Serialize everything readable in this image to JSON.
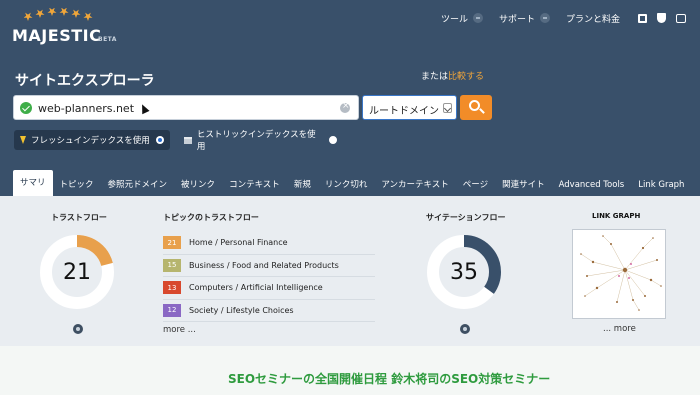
{
  "logo": {
    "name": "MAJESTIC",
    "beta": "BETA"
  },
  "topnav": {
    "tools": "ツール",
    "support": "サポート",
    "pricing": "プランと料金"
  },
  "page_title": "サイトエクスプローラ",
  "compare": {
    "prefix": "または",
    "link": "比較する"
  },
  "search": {
    "value": "web-planners.net",
    "scope": "ルートドメイン"
  },
  "index_options": {
    "fresh": "フレッシュインデックスを使用",
    "historic": "ヒストリックインデックスを使用",
    "selected": "fresh"
  },
  "tabs": [
    "サマリ",
    "トピック",
    "参照元ドメイン",
    "被リンク",
    "コンテキスト",
    "新規",
    "リンク切れ",
    "アンカーテキスト",
    "ページ",
    "関連サイト",
    "Advanced Tools",
    "Link Graph"
  ],
  "trust_flow": {
    "title": "トラストフロー",
    "value": "21"
  },
  "topical_trust_flow": {
    "title": "トピックのトラストフロー",
    "items": [
      {
        "value": "21",
        "label": "Home / Personal Finance",
        "color": "#e8a04c"
      },
      {
        "value": "15",
        "label": "Business / Food and Related Products",
        "color": "#b6b56e"
      },
      {
        "value": "13",
        "label": "Computers / Artificial Intelligence",
        "color": "#d8492e"
      },
      {
        "value": "12",
        "label": "Society / Lifestyle Choices",
        "color": "#8a68c4"
      }
    ],
    "more": "more ..."
  },
  "citation_flow": {
    "title": "サイテーションフロー",
    "value": "35"
  },
  "link_graph": {
    "title": "LINK GRAPH",
    "more": "... more"
  },
  "banner": "SEOセミナーの全国開催日程 鈴木将司のSEO対策セミナー",
  "colors": {
    "header": "#39506a",
    "accent": "#f28c28",
    "trust": "#e8a04c",
    "citation": "#39506a",
    "banner_text": "#2e9b3e"
  }
}
